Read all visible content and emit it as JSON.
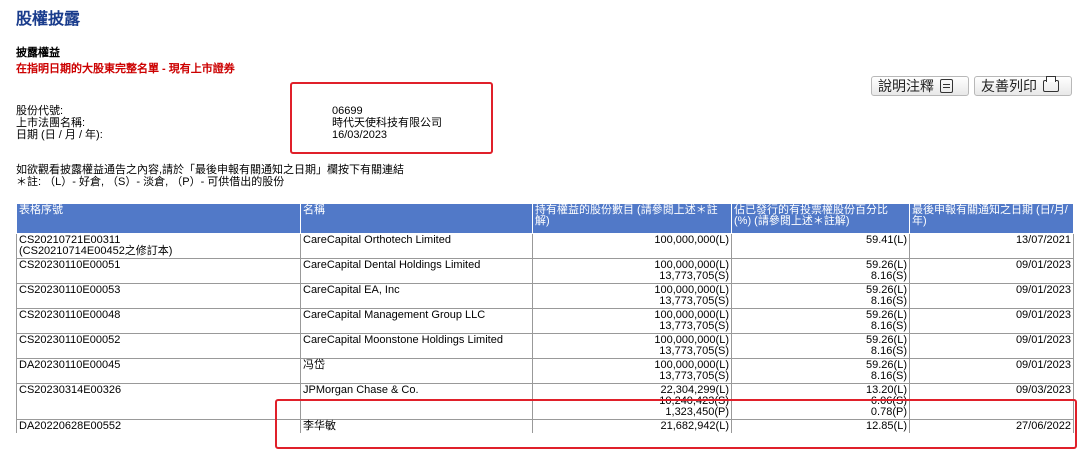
{
  "page": {
    "title": "股權披露",
    "subtitle": "披露權益",
    "red_line": "在指明日期的大股東完整名單 - 現有上市證券"
  },
  "toolbar": {
    "explain_label": "說明注釋",
    "print_label": "友善列印"
  },
  "info": {
    "code_label": "股份代號:",
    "code_value": "06699",
    "name_label": "上市法團名稱:",
    "name_value": "時代天使科技有限公司",
    "date_label": "日期 (日 / 月 / 年):",
    "date_value": "16/03/2023"
  },
  "notes": {
    "line1": "如欲觀看披露權益通告之內容,請於「最後申報有關通知之日期」欄按下有關連結",
    "line2": "＊註: （L）- 好倉, （S）- 淡倉, （P）- 可供借出的股份"
  },
  "table": {
    "headers": [
      "表格序號",
      "名稱",
      "持有權益的股份數目 (請參閱上述＊註解)",
      "佔已發行的有投票權股份百分比 (%) (請參閱上述＊註解)",
      "最後申報有關通知之日期 (日/月/年)"
    ],
    "rows": [
      {
        "form": "CS20210721E00311",
        "form_note": "(CS20210714E00452之修訂本)",
        "name": "CareCapital Orthotech Limited",
        "shares": [
          "100,000,000(L)"
        ],
        "pct": [
          "59.41(L)"
        ],
        "date": "13/07/2021"
      },
      {
        "form": "CS20230110E00051",
        "form_note": "",
        "name": "CareCapital Dental Holdings Limited",
        "shares": [
          "100,000,000(L)",
          "13,773,705(S)"
        ],
        "pct": [
          "59.26(L)",
          "8.16(S)"
        ],
        "date": "09/01/2023"
      },
      {
        "form": "CS20230110E00053",
        "form_note": "",
        "name": "CareCapital EA, Inc",
        "shares": [
          "100,000,000(L)",
          "13,773,705(S)"
        ],
        "pct": [
          "59.26(L)",
          "8.16(S)"
        ],
        "date": "09/01/2023"
      },
      {
        "form": "CS20230110E00048",
        "form_note": "",
        "name": "CareCapital Management Group LLC",
        "shares": [
          "100,000,000(L)",
          "13,773,705(S)"
        ],
        "pct": [
          "59.26(L)",
          "8.16(S)"
        ],
        "date": "09/01/2023"
      },
      {
        "form": "CS20230110E00052",
        "form_note": "",
        "name": "CareCapital Moonstone Holdings Limited",
        "shares": [
          "100,000,000(L)",
          "13,773,705(S)"
        ],
        "pct": [
          "59.26(L)",
          "8.16(S)"
        ],
        "date": "09/01/2023"
      },
      {
        "form": "DA20230110E00045",
        "form_note": "",
        "name": "冯岱",
        "shares": [
          "100,000,000(L)",
          "13,773,705(S)"
        ],
        "pct": [
          "59.26(L)",
          "8.16(S)"
        ],
        "date": "09/01/2023"
      },
      {
        "form": "CS20230314E00326",
        "form_note": "",
        "name": "JPMorgan Chase & Co.",
        "shares": [
          "22,304,299(L)",
          "10,240,423(S)",
          "1,323,450(P)"
        ],
        "pct": [
          "13.20(L)",
          "6.06(S)",
          "0.78(P)"
        ],
        "date": "09/03/2023"
      },
      {
        "form": "DA20220628E00552",
        "form_note": "",
        "name": "李华敏",
        "shares": [
          "21,682,942(L)"
        ],
        "pct": [
          "12.85(L)"
        ],
        "date": "27/06/2022"
      }
    ]
  },
  "colors": {
    "header_bg": "#5179c8",
    "title": "#1a3c8c",
    "highlight_box": "#e0202a"
  }
}
